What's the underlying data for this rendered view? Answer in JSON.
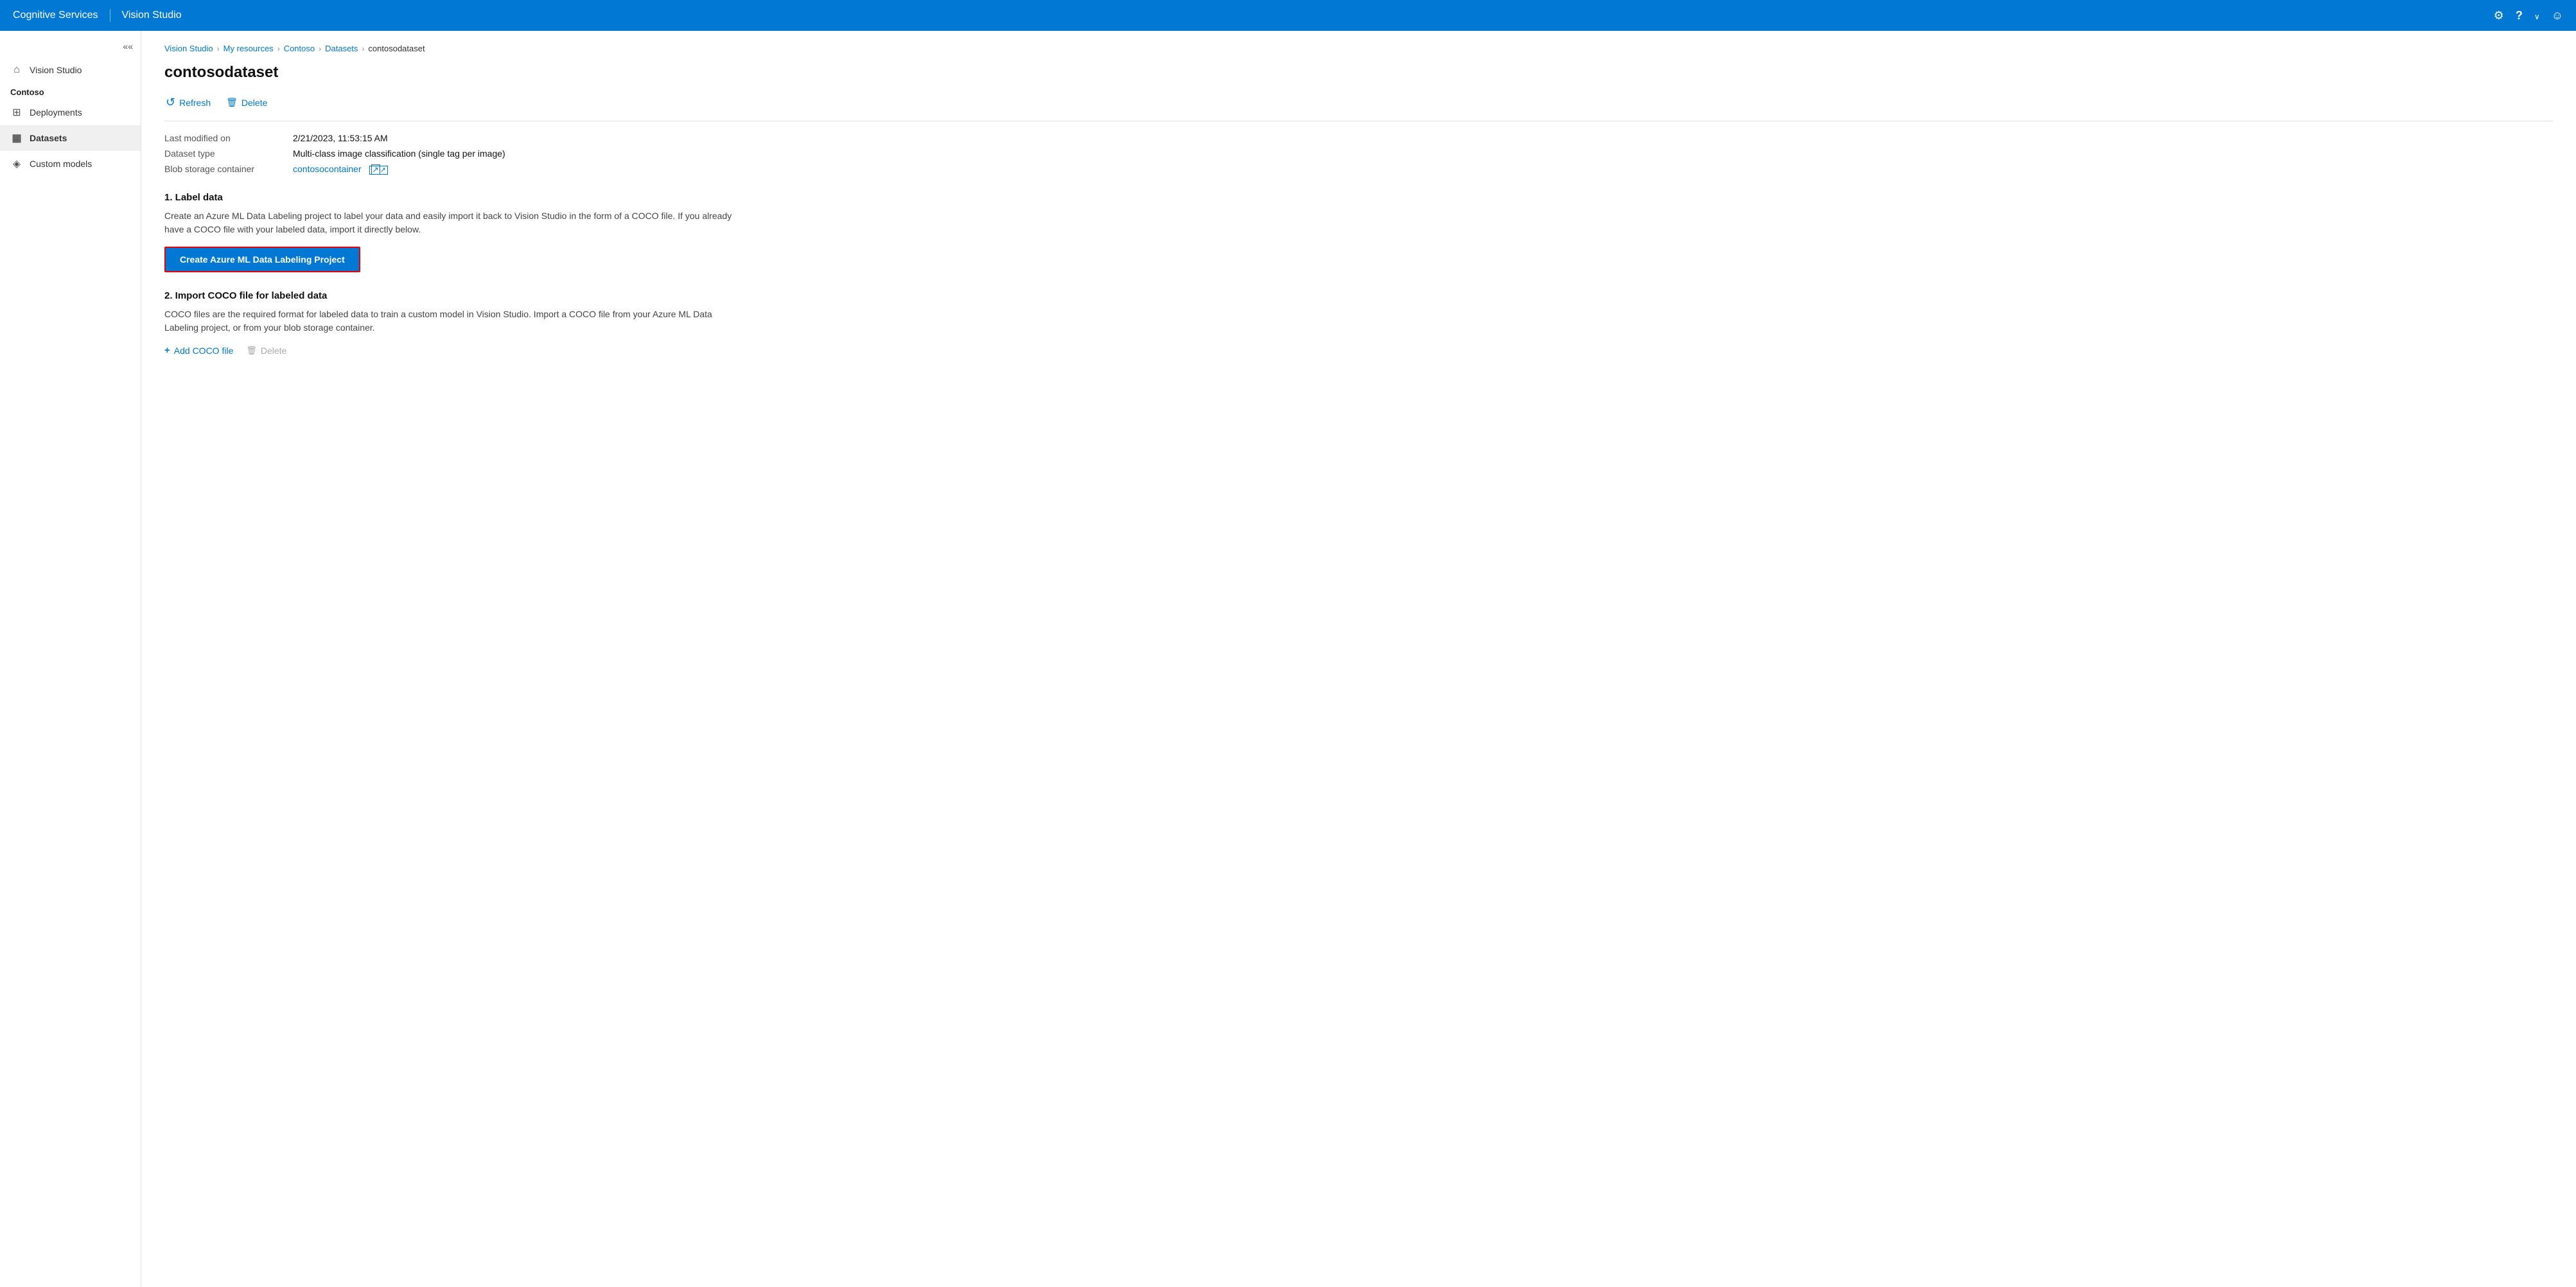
{
  "app": {
    "title_prefix": "Cognitive Services",
    "title_separator": "|",
    "title_suffix": "Vision Studio"
  },
  "topbar": {
    "gear_icon": "gear",
    "help_icon": "question",
    "chevron_icon": "chevron",
    "user_icon": "user"
  },
  "sidebar": {
    "collapse_label": "«",
    "section_label": "Contoso",
    "items": [
      {
        "id": "vision-studio",
        "label": "Vision Studio",
        "icon": "home"
      },
      {
        "id": "deployments",
        "label": "Deployments",
        "icon": "deployments"
      },
      {
        "id": "datasets",
        "label": "Datasets",
        "icon": "datasets",
        "active": true
      },
      {
        "id": "custom-models",
        "label": "Custom models",
        "icon": "models"
      }
    ]
  },
  "breadcrumb": {
    "items": [
      {
        "label": "Vision Studio",
        "href": "#"
      },
      {
        "label": "My resources",
        "href": "#"
      },
      {
        "label": "Contoso",
        "href": "#"
      },
      {
        "label": "Datasets",
        "href": "#"
      },
      {
        "label": "contosodataset",
        "current": true
      }
    ]
  },
  "page": {
    "title": "contosodataset",
    "toolbar": {
      "refresh_label": "Refresh",
      "delete_label": "Delete"
    },
    "metadata": {
      "last_modified_label": "Last modified on",
      "last_modified_value": "2/21/2023, 11:53:15 AM",
      "dataset_type_label": "Dataset type",
      "dataset_type_value": "Multi-class image classification (single tag per image)",
      "blob_storage_label": "Blob storage container",
      "blob_storage_link": "contosocontainer",
      "blob_storage_href": "#"
    },
    "section1": {
      "title": "1. Label data",
      "description": "Create an Azure ML Data Labeling project to label your data and easily import it back to Vision Studio in the form of a COCO file. If you already have a COCO file with your labeled data, import it directly below.",
      "button_label": "Create Azure ML Data Labeling Project"
    },
    "section2": {
      "title": "2. Import COCO file for labeled data",
      "description": "COCO files are the required format for labeled data to train a custom model in Vision Studio. Import a COCO file from your Azure ML Data Labeling project, or from your blob storage container.",
      "add_label": "Add COCO file",
      "delete_label": "Delete"
    }
  }
}
